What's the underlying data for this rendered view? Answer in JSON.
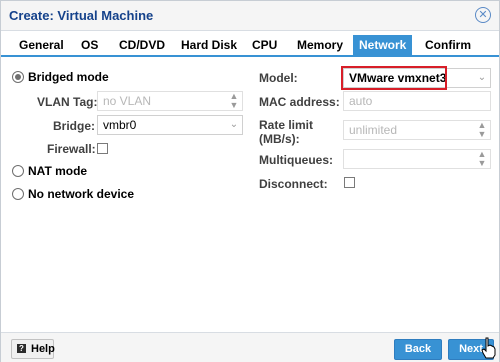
{
  "window": {
    "title": "Create: Virtual Machine"
  },
  "tabs": [
    {
      "label": "General"
    },
    {
      "label": "OS"
    },
    {
      "label": "CD/DVD"
    },
    {
      "label": "Hard Disk"
    },
    {
      "label": "CPU"
    },
    {
      "label": "Memory"
    },
    {
      "label": "Network",
      "active": true
    },
    {
      "label": "Confirm"
    }
  ],
  "left": {
    "bridged_mode": "Bridged mode",
    "vlan_tag": {
      "label": "VLAN Tag:",
      "placeholder": "no VLAN"
    },
    "bridge": {
      "label": "Bridge:",
      "value": "vmbr0"
    },
    "firewall": {
      "label": "Firewall:"
    },
    "nat_mode": "NAT mode",
    "no_network": "No network device"
  },
  "right": {
    "model": {
      "label": "Model:",
      "value": "VMware vmxnet3"
    },
    "mac": {
      "label": "MAC address:",
      "placeholder": "auto"
    },
    "rate_limit": {
      "label": "Rate limit",
      "label2": "(MB/s):",
      "placeholder": "unlimited"
    },
    "multiqueues": {
      "label": "Multiqueues:"
    },
    "disconnect": {
      "label": "Disconnect:"
    }
  },
  "footer": {
    "help": "Help",
    "back": "Back",
    "next": "Next"
  },
  "icons": {
    "close": "close-icon",
    "help": "help-icon",
    "cursor": "hand-cursor-icon"
  },
  "colors": {
    "accent": "#3892d4",
    "title": "#15428b",
    "highlight": "#d81e28"
  }
}
